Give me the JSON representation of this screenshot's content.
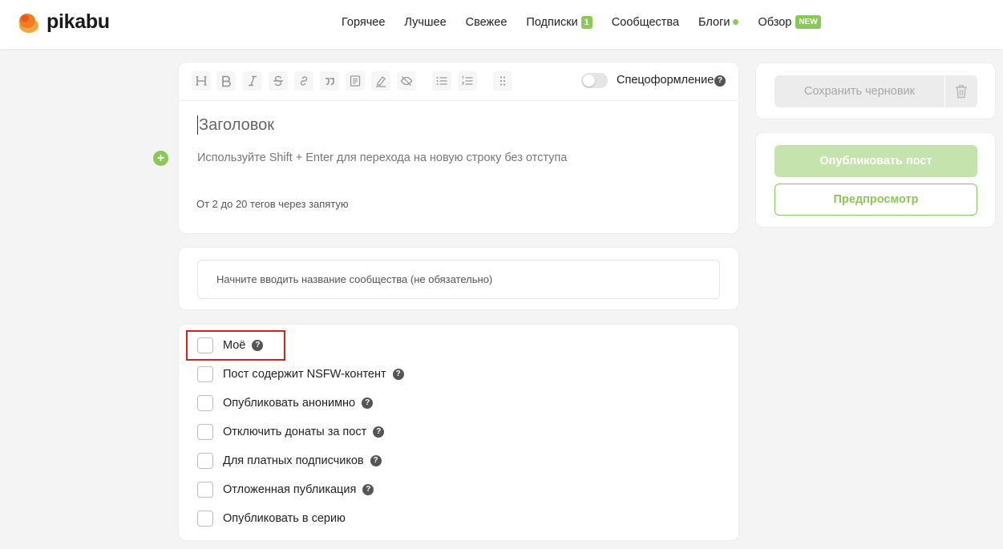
{
  "brand": {
    "name": "pikabu",
    "accent": "#8ac858",
    "logo_color": "#f07d22"
  },
  "nav": {
    "items": [
      {
        "label": "Горячее"
      },
      {
        "label": "Лучшее"
      },
      {
        "label": "Свежее"
      },
      {
        "label": "Подписки",
        "badge": "1"
      },
      {
        "label": "Сообщества"
      },
      {
        "label": "Блоги",
        "dot": true
      },
      {
        "label": "Обзор",
        "badge_new": "NEW"
      }
    ]
  },
  "editor": {
    "toolbar": {
      "buttons": [
        "heading-icon",
        "bold-icon",
        "italic-icon",
        "strikethrough-icon",
        "link-icon",
        "quote-icon",
        "spoiler-icon",
        "highlight-icon",
        "hidden-text-icon",
        "bullet-list-icon",
        "numbered-list-icon",
        "drag-handle-icon"
      ],
      "spec_label": "Спецоформление",
      "spec_enabled": false
    },
    "title_placeholder": "Заголовок",
    "body_placeholder": "Используйте Shift + Enter для перехода на новую строку без отступа",
    "tags_placeholder": "От 2 до 20 тегов через запятую"
  },
  "community": {
    "placeholder": "Начните вводить название сообщества (не обязательно)"
  },
  "options": [
    {
      "label": "Моё",
      "help": true,
      "checked": false
    },
    {
      "label": "Пост содержит NSFW-контент",
      "help": true,
      "checked": false
    },
    {
      "label": "Опубликовать анонимно",
      "help": true,
      "checked": false
    },
    {
      "label": "Отключить донаты за пост",
      "help": true,
      "checked": false
    },
    {
      "label": "Для платных подписчиков",
      "help": true,
      "checked": false
    },
    {
      "label": "Отложенная публикация",
      "help": true,
      "checked": false
    },
    {
      "label": "Опубликовать в серию",
      "help": false,
      "checked": false
    }
  ],
  "sidebar": {
    "save_draft": "Сохранить черновик",
    "publish": "Опубликовать пост",
    "preview": "Предпросмотр"
  }
}
